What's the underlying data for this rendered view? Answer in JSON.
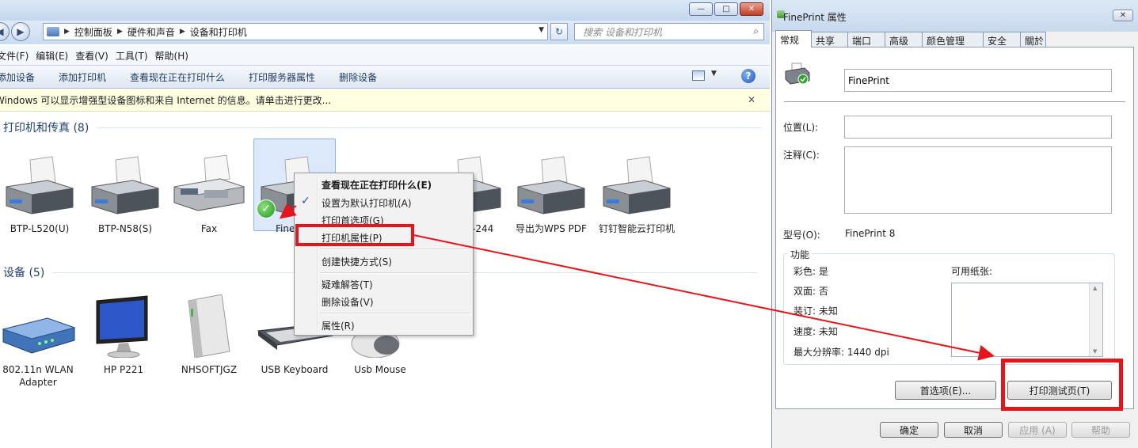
{
  "explorer": {
    "address": {
      "items": [
        "控制面板",
        "硬件和声音",
        "设备和打印机"
      ]
    },
    "search": {
      "placeholder": "搜索 设备和打印机"
    },
    "menu": [
      "文件(F)",
      "编辑(E)",
      "查看(V)",
      "工具(T)",
      "帮助(H)"
    ],
    "commands": [
      "添加设备",
      "添加打印机",
      "查看现在正在打印什么",
      "打印服务器属性",
      "删除设备"
    ],
    "infobar": "Windows 可以显示增强型设备图标和来自 Internet 的信息。请单击进行更改...",
    "groups": {
      "printers": {
        "title": "打印机和传真 (8)"
      },
      "devices": {
        "title": "设备 (5)"
      }
    },
    "printers": [
      {
        "label": "BTP-L520(U)"
      },
      {
        "label": "BTP-N58(S)"
      },
      {
        "label": "Fax"
      },
      {
        "label": "Fine"
      },
      {
        "label": "-244"
      },
      {
        "label": "导出为WPS PDF"
      },
      {
        "label": "钉钉智能云打印机"
      }
    ],
    "devices": [
      {
        "label": "802.11n WLAN Adapter"
      },
      {
        "label": "HP P221"
      },
      {
        "label": "NHSOFTJGZ"
      },
      {
        "label": "USB Keyboard"
      },
      {
        "label": "Usb Mouse"
      }
    ],
    "context_menu": {
      "items": [
        {
          "label": "查看现在正在打印什么(E)",
          "bold": true
        },
        {
          "label": "设置为默认打印机(A)",
          "checked": true
        },
        {
          "label": "打印首选项(G)"
        },
        {
          "label": "打印机属性(P)",
          "highlighted": true
        },
        {
          "label": "创建快捷方式(S)"
        },
        {
          "label": "疑难解答(T)"
        },
        {
          "label": "删除设备(V)"
        },
        {
          "label": "属性(R)"
        }
      ]
    }
  },
  "dialog": {
    "title": "FinePrint 属性",
    "tabs": [
      "常规",
      "共享",
      "端口",
      "高级",
      "颜色管理",
      "安全",
      "關於"
    ],
    "active_tab": "常规",
    "printer_name": "FinePrint",
    "location_label": "位置(L):",
    "location_value": "",
    "comment_label": "注释(C):",
    "comment_value": "",
    "model_label": "型号(O):",
    "model_value": "FinePrint 8",
    "features": {
      "legend": "功能",
      "color": "彩色: 是",
      "duplex": "双面: 否",
      "staple": "装订: 未知",
      "speed": "速度: 未知",
      "resolution": "最大分辨率: 1440 dpi",
      "paper_label": "可用纸张:"
    },
    "buttons": {
      "preferences": "首选项(E)...",
      "print_test": "打印测试页(T)",
      "ok": "确定",
      "cancel": "取消",
      "apply": "应用 (A)",
      "help": "帮助"
    }
  },
  "colors": {
    "annotation_red": "#e8141b",
    "info_bar_bg": "#ffffe1",
    "selection_bg": "#dbe9fb"
  }
}
